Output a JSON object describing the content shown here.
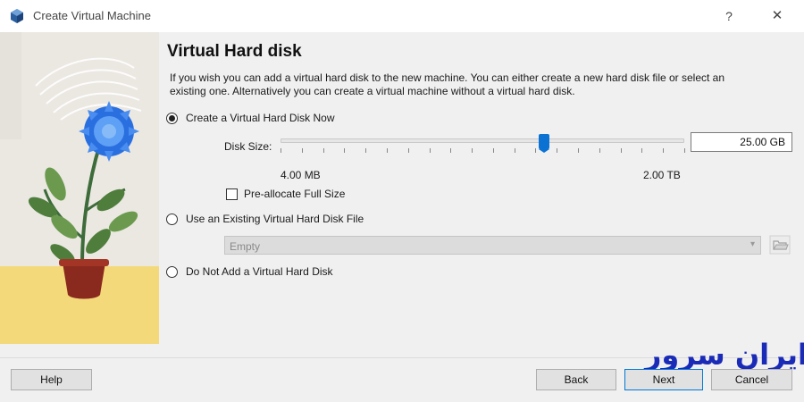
{
  "window": {
    "title": "Create Virtual Machine",
    "help_glyph": "?",
    "close_glyph": "✕",
    "icon": "virtualbox-cube-icon"
  },
  "page": {
    "heading": "Virtual Hard disk",
    "description": "If you wish you can add a virtual hard disk to the new machine. You can either create a new hard disk file or select an existing one. Alternatively you can create a virtual machine without a virtual hard disk."
  },
  "options": {
    "create_now": {
      "label": "Create a Virtual Hard Disk Now",
      "selected": true
    },
    "use_existing": {
      "label": "Use an Existing Virtual Hard Disk File",
      "selected": false
    },
    "do_not_add": {
      "label": "Do Not Add a Virtual Hard Disk",
      "selected": false
    }
  },
  "disk_size": {
    "label": "Disk Size:",
    "value": "25.00 GB",
    "min_label": "4.00 MB",
    "max_label": "2.00 TB",
    "slider_fraction": 0.65,
    "tick_count": 20
  },
  "preallocate": {
    "label": "Pre-allocate Full Size",
    "checked": false
  },
  "existing_disk": {
    "selected": "Empty",
    "folder_icon": "folder-open-icon"
  },
  "buttons": {
    "help": "Help",
    "back": "Back",
    "next": "Next",
    "cancel": "Cancel"
  },
  "watermark": {
    "text": "ایران سرور"
  },
  "colors": {
    "accent": "#0b72d4",
    "watermark": "#1a2bb8",
    "dialog_bg": "#f0f0f0"
  }
}
